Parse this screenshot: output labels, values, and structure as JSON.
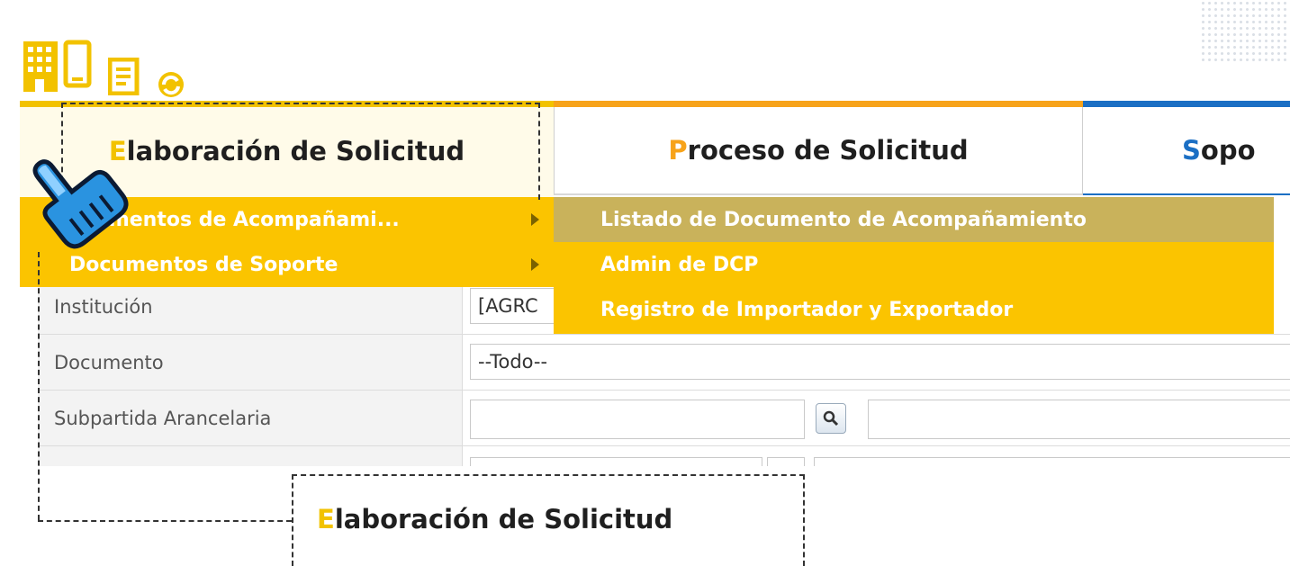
{
  "header": {
    "icons": [
      "building-icon",
      "phone-icon",
      "document-icon",
      "refresh-icon"
    ]
  },
  "tabs": [
    {
      "first": "E",
      "rest": "laboración de Solicitud"
    },
    {
      "first": "P",
      "rest": "roceso de Solicitud"
    },
    {
      "first": "S",
      "rest": "opo"
    }
  ],
  "menu": {
    "items": [
      {
        "label": "ocumentos de Acompañami..."
      },
      {
        "label": "Documentos de Soporte"
      }
    ],
    "submenu": [
      {
        "label": "Listado de Documento de Acompañamiento"
      },
      {
        "label": "Admin de DCP"
      },
      {
        "label": "Registro de Importador y Exportador"
      }
    ]
  },
  "form": {
    "rows": [
      {
        "label": "Institución",
        "value": "[AGRC"
      },
      {
        "label": "Documento",
        "value": "--Todo--"
      },
      {
        "label": "Subpartida Arancelaria",
        "value": ""
      }
    ]
  },
  "callout": {
    "first": "E",
    "rest": "laboración de Solicitud"
  },
  "colors": {
    "accent_gold": "#fbc400",
    "accent_orange": "#f7a31a",
    "accent_blue": "#1b6fc4",
    "hover": "#c9b25b"
  }
}
